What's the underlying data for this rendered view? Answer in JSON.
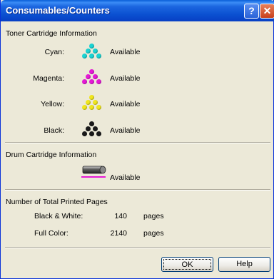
{
  "window": {
    "title": "Consumables/Counters",
    "help_glyph": "?",
    "close_glyph": "✕"
  },
  "toner": {
    "section_title": "Toner Cartridge Information",
    "items": [
      {
        "label": "Cyan:",
        "status": "Available",
        "color": "#19d3d3"
      },
      {
        "label": "Magenta:",
        "status": "Available",
        "color": "#e619d6"
      },
      {
        "label": "Yellow:",
        "status": "Available",
        "color": "#f0e61e"
      },
      {
        "label": "Black:",
        "status": "Available",
        "color": "#1a1a1a"
      }
    ]
  },
  "drum": {
    "section_title": "Drum Cartridge Information",
    "status": "Available",
    "accent_color": "#e619d6"
  },
  "pages": {
    "section_title": "Number of Total Printed Pages",
    "rows": [
      {
        "label": "Black & White:",
        "value": "140",
        "unit": "pages"
      },
      {
        "label": "Full Color:",
        "value": "2140",
        "unit": "pages"
      }
    ]
  },
  "buttons": {
    "ok": "OK",
    "help": "Help"
  }
}
